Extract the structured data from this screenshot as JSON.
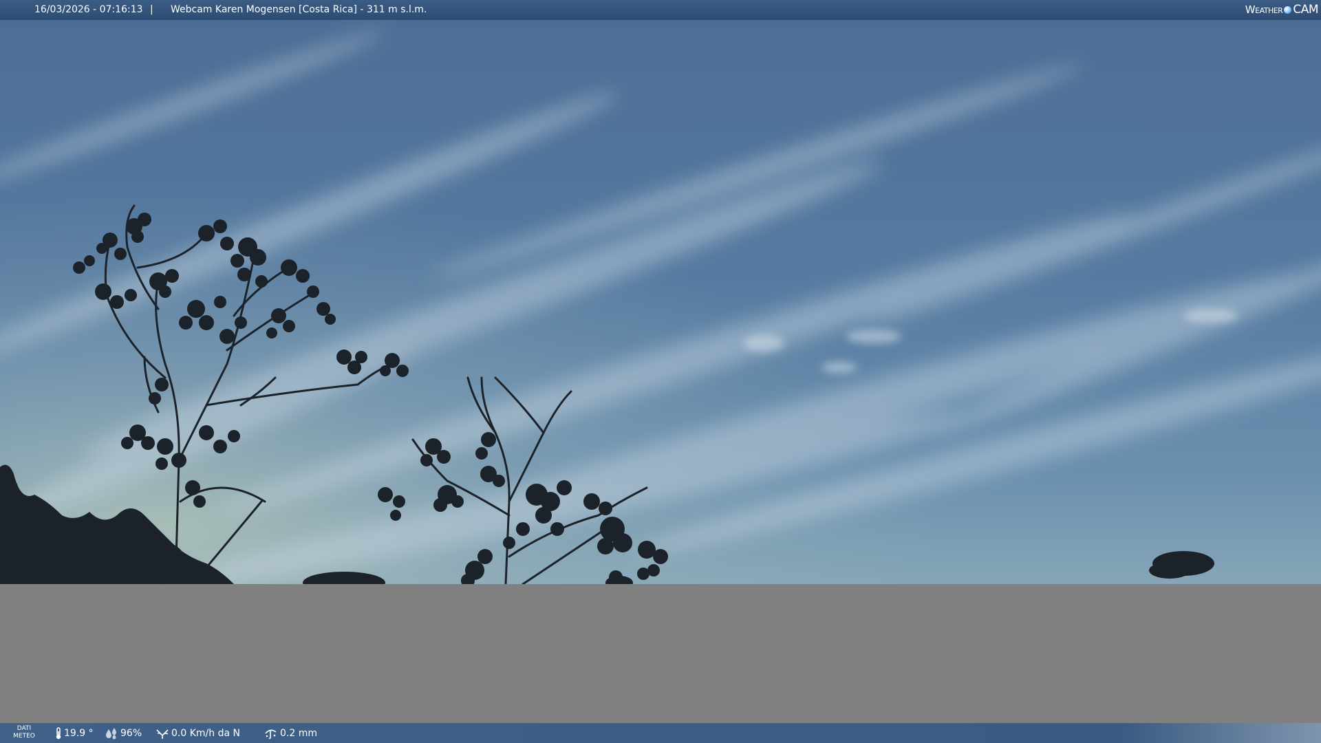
{
  "topbar": {
    "datetime": "16/03/2026 - 07:16:13",
    "separator": "|",
    "camera_title": "Webcam Karen Mogensen [Costa Rica]  - 311 m s.l.m.",
    "logo_left": "Weather",
    "logo_right": "CAM"
  },
  "bottombar": {
    "dati_line1": "DATI",
    "dati_line2": "METEO",
    "temperature": "19.9 °",
    "humidity": "96%",
    "wind": "0.0 Km/h da N",
    "rain": "0.2 mm"
  },
  "icons": {
    "temperature": "thermometer-icon",
    "humidity": "humidity-drops-icon",
    "wind": "wind-icon",
    "rain": "rain-gauge-icon",
    "logo": "weathercam-globe-icon"
  },
  "colors": {
    "topbar_bg": "#2d4c74",
    "bottombar_bg": "#3a5b82",
    "gray_panel": "#808080",
    "sky_top": "#4f7098",
    "sky_horizon": "#93b0bd",
    "silhouette": "#1b2229"
  }
}
